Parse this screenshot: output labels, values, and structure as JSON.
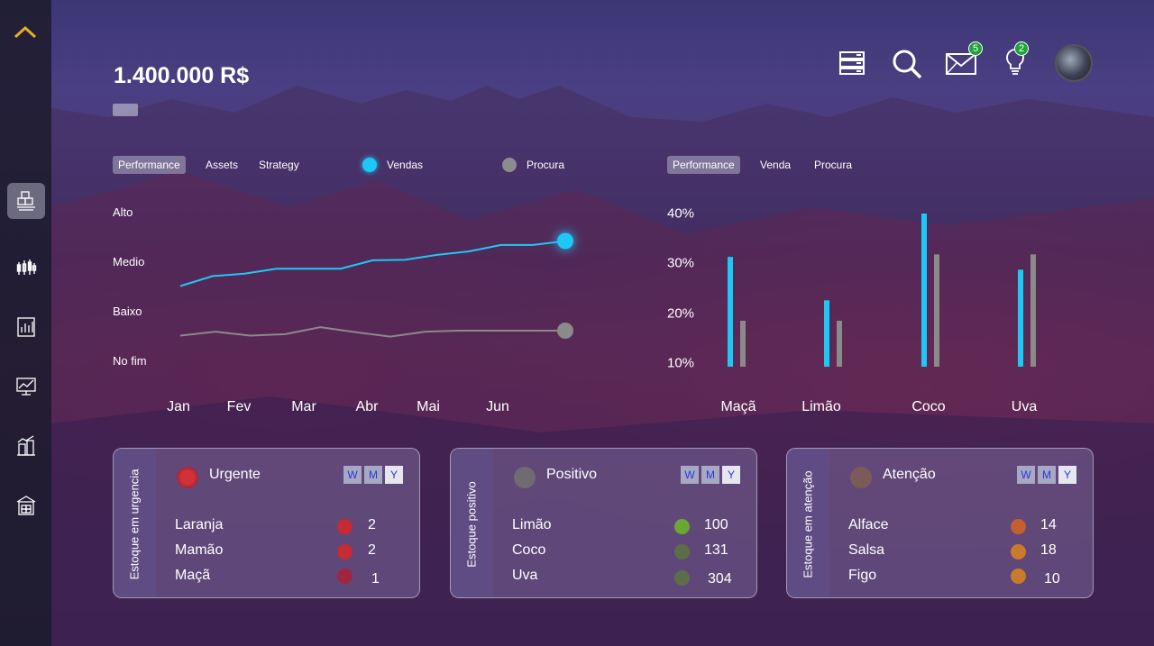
{
  "header": {
    "amount": "1.400.000 R$",
    "notifications": {
      "mail_badge": "5",
      "ideas_badge": "2"
    }
  },
  "icons": {
    "sidebar": [
      "chevron-up-icon",
      "boxes-icon",
      "candlestick-icon",
      "bar-report-icon",
      "trend-board-icon",
      "building-chart-icon",
      "warehouse-icon"
    ],
    "top": [
      "server-icon",
      "search-icon",
      "mail-icon",
      "lightbulb-icon",
      "avatar"
    ]
  },
  "colors": {
    "accent": "#1ec8f5",
    "secondary": "#8a8a8a",
    "urgent": "#c62a32",
    "positive": "#6aa832",
    "attention": "#d06a34",
    "caret": "#e2b21f"
  },
  "line_panel": {
    "tabs": [
      "Performance",
      "Assets",
      "Strategy"
    ],
    "selected_tab": "Performance",
    "legend": [
      {
        "label": "Vendas",
        "color": "#1ec8f5"
      },
      {
        "label": "Procura",
        "color": "#8c8c8c"
      }
    ]
  },
  "bar_panel": {
    "tabs": [
      "Performance",
      "Venda",
      "Procura"
    ],
    "selected_tab": "Performance"
  },
  "chart_data": [
    {
      "type": "line",
      "x": [
        "Jan",
        "Fev",
        "Mar",
        "Abr",
        "Mai",
        "Jun"
      ],
      "y_categories": [
        "No fim",
        "Baixo",
        "Medio",
        "Alto"
      ],
      "series": [
        {
          "name": "Vendas",
          "values": [
            1.5,
            1.7,
            1.75,
            1.85,
            1.85,
            1.85,
            2.02,
            2.03,
            2.13,
            2.2,
            2.33,
            2.33,
            2.41
          ]
        },
        {
          "name": "Procura",
          "values": [
            0.5,
            0.58,
            0.5,
            0.53,
            0.67,
            0.57,
            0.48,
            0.58,
            0.6,
            0.6,
            0.6,
            0.6
          ]
        }
      ],
      "grid": false
    },
    {
      "type": "bar",
      "categories": [
        "Maçã",
        "Limão",
        "Coco",
        "Uva"
      ],
      "yticks": [
        "10%",
        "20%",
        "30%",
        "40%"
      ],
      "ylim": [
        10,
        40
      ],
      "series": [
        {
          "name": "Venda",
          "values": [
            31.5,
            23,
            40,
            29
          ]
        },
        {
          "name": "Procura",
          "values": [
            19,
            19,
            32,
            32
          ]
        }
      ]
    }
  ],
  "cards": [
    {
      "side_label": "Estoque em urgencia",
      "title": "Urgente",
      "wmy": [
        "W",
        "M",
        "Y"
      ],
      "rows": [
        {
          "name": "Laranja",
          "value": "2"
        },
        {
          "name": "Mamão",
          "value": "2"
        },
        {
          "name": "Maçã",
          "value": "1"
        }
      ]
    },
    {
      "side_label": "Estoque positivo",
      "title": "Positivo",
      "wmy": [
        "W",
        "M",
        "Y"
      ],
      "rows": [
        {
          "name": "Limão",
          "value": "100"
        },
        {
          "name": "Coco",
          "value": "131"
        },
        {
          "name": "Uva",
          "value": "304"
        }
      ]
    },
    {
      "side_label": "Estoque em atenção",
      "title": "Atenção",
      "wmy": [
        "W",
        "M",
        "Y"
      ],
      "rows": [
        {
          "name": "Alface",
          "value": "14"
        },
        {
          "name": "Salsa",
          "value": "18"
        },
        {
          "name": "Figo",
          "value": "10"
        }
      ]
    }
  ]
}
